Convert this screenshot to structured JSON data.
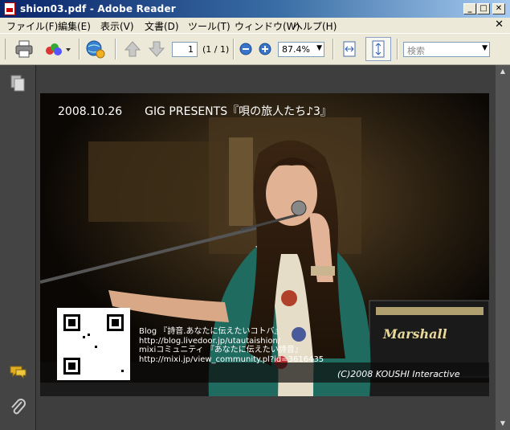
{
  "window": {
    "title": "shion03.pdf - Adobe Reader",
    "controls": {
      "minimize": "_",
      "maximize": "□",
      "close": "✕"
    }
  },
  "menu": {
    "items": [
      "ファイル(F)",
      "編集(E)",
      "表示(V)",
      "文書(D)",
      "ツール(T)",
      "ウィンドウ(W)",
      "ヘルプ(H)"
    ],
    "doc_close": "✕"
  },
  "toolbar": {
    "page_current": "1",
    "page_total": "(1 / 1)",
    "zoom": "87.4%",
    "search_placeholder": "検索"
  },
  "document": {
    "header": "2008.10.26　　GIG PRESENTS『唄の旅人たち♪3』",
    "lines": [
      "Blog 『詩音.あなたに伝えたいコトバ』",
      "http://blog.livedoor.jp/utautaishion/",
      "mixiコミュニティ 『あなたに伝えたい詩音』",
      "http://mixi.jp/view_community.pl?id=3616435"
    ],
    "copyright": "(C)2008 KOUSHI Interactive",
    "amp_brand": "Marshall"
  }
}
